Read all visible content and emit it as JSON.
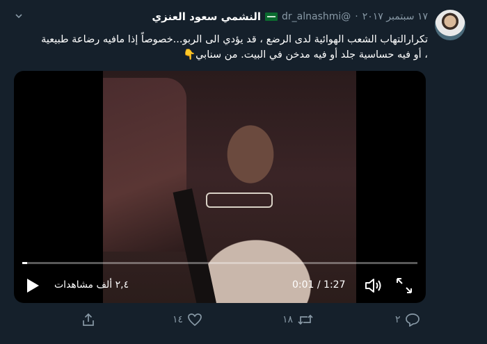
{
  "tweet": {
    "name": "النشمي سعود العنزي",
    "handle": "@dr_alnashmi",
    "separator": "·",
    "date": "١٧ سبتمبر ٢٠١٧",
    "text": "تكرارالتهاب الشعب الهوائية لدى الرضع ، قد يؤدي الى الربو...خصوصاً إذا مافيه رضاعة طبيعية ، أو فيه حساسية جلد أو فيه مدخن في البيت. من سنابي👇"
  },
  "video": {
    "views": "٢,٤ ألف مشاهدات",
    "time": "0:01 / 1:27",
    "progress_fraction": 0.012
  },
  "actions": {
    "reply_count": "٢",
    "retweet_count": "١٨",
    "like_count": "١٤"
  },
  "colors": {
    "background": "#15202b",
    "secondary_text": "#8899a6",
    "flag_green": "#0b6b2f"
  },
  "icons": {
    "caret": "chevron-down-icon",
    "play": "play-icon",
    "volume": "volume-icon",
    "fullscreen": "fullscreen-icon",
    "reply": "reply-icon",
    "retweet": "retweet-icon",
    "like": "heart-icon",
    "share": "share-icon"
  }
}
